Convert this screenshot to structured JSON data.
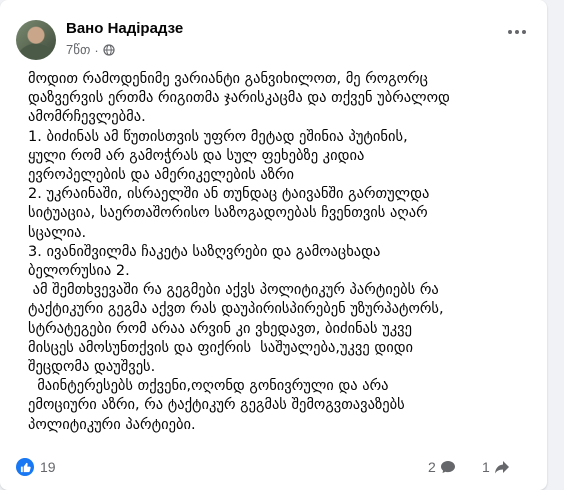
{
  "post": {
    "author": "Вано Надірадзе",
    "time": "7წთ",
    "separator": "·",
    "body_lines": [
      "მოდით რამოდენიმე ვარიანტი განვიხილოთ, მე როგორც",
      "დაზვერვის ერთმა რიგითმა ჯარისკაცმა და თქვენ უბრალოდ",
      "ამომრჩევლებმა.",
      "1. ბიძინას ამ წუთისთვის უფრო მეტად ეშინია პუტინის,",
      "ყული რომ არ გამოჭრას და სულ ფეხებზე კიდია",
      "ევროპელების და ამერიკელების აზრი",
      "2. უკრაინაში, ისრაელში ან თუნდაც ტაივანში გართულდა",
      "სიტუაცია, საერთაშორისო საზოგადოებას ჩვენთვის აღარ",
      "სცალია.",
      "3. ივანიშვილმა ჩაკეტა საზღვრები და გამოაცხადა",
      "ბელორუსია 2.",
      " ამ შემთხვევაში რა გეგმები აქვს პოლიტიკურ პარტიებს რა",
      "ტაქტიკური გეგმა აქვთ რას დაუპირისპირებენ უზურპატორს,",
      "სტრატეგები რომ არაა არვინ კი ვხედავთ, ბიძინას უკვე",
      "მისცეს ამოსუნთქვის და ფიქრის  საშუალება,უკვე დიდი",
      "შეცდომა დაუშვეს.",
      "  მაინტერესებს თქვენი,ოღონდ გონივრული და არა",
      "ემოციური აზრი, რა ტაქტიკურ გეგმას შემოგვთავაზებს",
      "პოლიტიკური პარტიები."
    ]
  },
  "footer": {
    "likes": "19",
    "comments": "2",
    "shares": "1"
  },
  "icons": {
    "like": "thumbs-up-icon",
    "comment": "comment-bubble-icon",
    "share": "share-arrow-icon",
    "privacy": "globe-icon",
    "more": "more-options-icon"
  },
  "colors": {
    "accent": "#1877f2",
    "muted": "#65676b",
    "text": "#050505",
    "background": "#f0f2f5"
  }
}
